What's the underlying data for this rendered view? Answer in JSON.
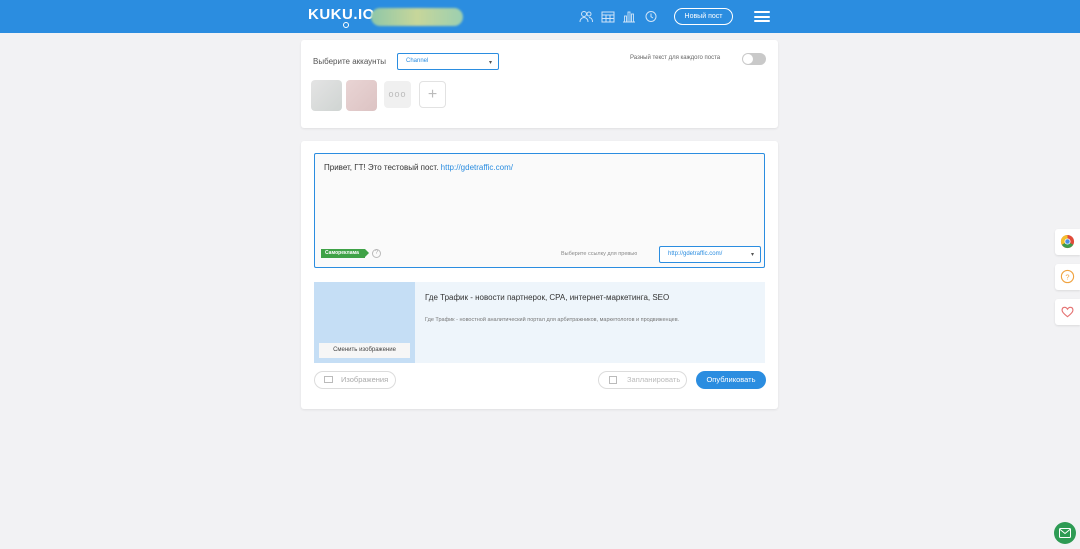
{
  "header": {
    "logo": "KUKU.IO",
    "new_post_label": "Новый пост",
    "icons": [
      "users-icon",
      "calendar-icon",
      "stats-icon",
      "clock-icon",
      "menu-icon"
    ],
    "brand_color": "#2b8de0"
  },
  "accounts": {
    "label": "Выберите аккаунты",
    "select_value": "Channel",
    "diff_text_label": "Разный текст для каждого поста",
    "more_label": "ooo",
    "add_label": "+"
  },
  "editor": {
    "text": "Привет, ГТ! Это тестовый пост.",
    "link": "http://gdetraffic.com/",
    "self_ad_badge": "Самореклама",
    "help": "?",
    "preview_link_label": "Выберите ссылку для превью",
    "preview_link_value": "http://gdetraffic.com/"
  },
  "preview": {
    "change_image_label": "Сменить изображение",
    "title": "Где Трафик - новости партнерок, CPA, интернет-маркетинга, SEO",
    "description": "Где Трафик - новостной аналитический портал для арбитражников, маркетологов и продвиженцев."
  },
  "actions": {
    "images_label": "Изображения",
    "schedule_label": "Запланировать",
    "publish_label": "Опубликовать"
  },
  "side": {
    "icons": [
      "chrome-icon",
      "help-icon",
      "heart-icon",
      "chat-icon"
    ]
  }
}
